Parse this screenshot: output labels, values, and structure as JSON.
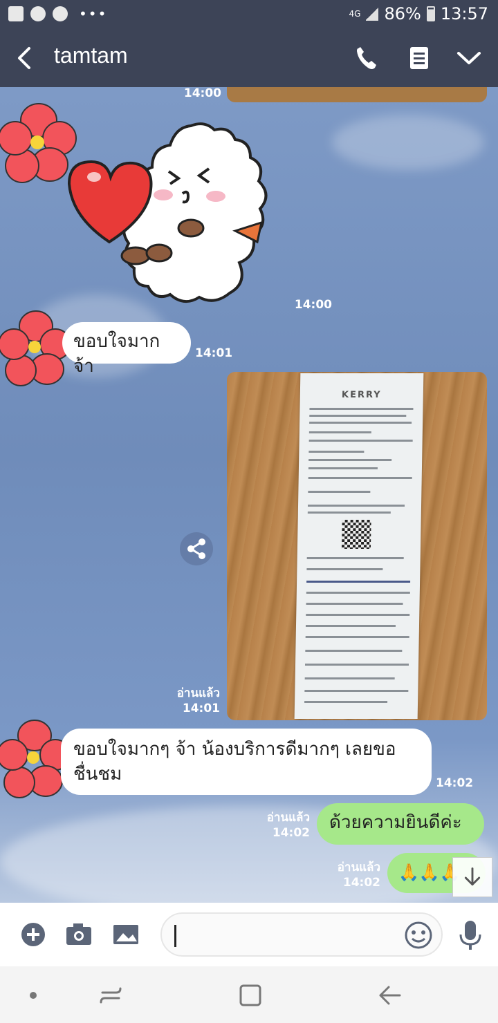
{
  "status": {
    "network": "4G",
    "battery": "86%",
    "time": "13:57"
  },
  "header": {
    "title": "tamtam"
  },
  "colors": {
    "header_bg": "#3d4457",
    "outgoing_bubble": "#a6e88a",
    "incoming_bubble": "#ffffff"
  },
  "messages": {
    "m0_time": "14:00",
    "m1_time": "14:00",
    "m2_text": "ขอบใจมากจ้า",
    "m2_time": "14:01",
    "m3_read": "อ่านแล้ว",
    "m3_time": "14:01",
    "m3_receipt_brand": "KERRY",
    "m4_text": "ขอบใจมากๆ จ้า น้องบริการดีมากๆ เลยขอ ชื่นชม",
    "m4_time": "14:02",
    "m5_text": "ด้วยความยินดีค่ะ",
    "m5_read": "อ่านแล้ว",
    "m5_time": "14:02",
    "m6_text": "🙏🙏🙏",
    "m6_read": "อ่านแล้ว",
    "m6_time": "14:02"
  },
  "input": {
    "value": ""
  },
  "icons": {
    "header": [
      "back-arrow-icon",
      "phone-icon",
      "notes-icon",
      "chevron-down-icon"
    ],
    "input": [
      "add-icon",
      "camera-icon",
      "image-icon",
      "emoji-icon",
      "microphone-icon"
    ],
    "nav": [
      "dot-icon",
      "recent-apps-icon",
      "home-icon",
      "back-icon"
    ]
  }
}
